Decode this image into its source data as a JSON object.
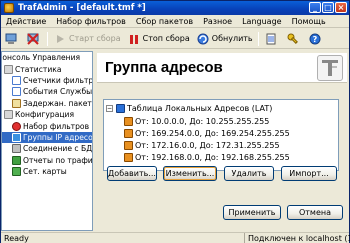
{
  "window": {
    "title": "TrafAdmin - [default.tmf *]"
  },
  "menu": [
    "Действие",
    "Набор фильтров",
    "Сбор пакетов",
    "Разное",
    "Language",
    "Помощь"
  ],
  "toolbar": {
    "start_capture": "Старт сбора",
    "stop_capture": "Стоп сбора",
    "refresh": "Обнулить"
  },
  "tree": {
    "items": [
      "Консоль Управления",
      "Статистика",
      "Счетчики фильтров",
      "События Службы",
      "Задержан. пакеты",
      "Конфигурация",
      "Набор фильтров",
      "Группы IP адресов",
      "Соединение с БД",
      "Отчеты по трафику",
      "Сет. карты"
    ],
    "selected_index": 7
  },
  "panel": {
    "title": "Группа адресов",
    "list": {
      "root": "Таблица Локальных Адресов (LAT)",
      "ranges": [
        "От: 10.0.0.0, До: 10.255.255.255",
        "От: 169.254.0.0, До: 169.254.255.255",
        "От: 172.16.0.0, До: 172.31.255.255",
        "От: 192.168.0.0, До: 192.168.255.255"
      ]
    },
    "buttons": {
      "add": "Добавить...",
      "edit": "Изменить...",
      "delete": "Удалить",
      "import": "Импорт...",
      "apply": "Применить",
      "cancel": "Отмена"
    }
  },
  "status": {
    "left": "Ready",
    "right": "Подключен к localhost (127"
  }
}
